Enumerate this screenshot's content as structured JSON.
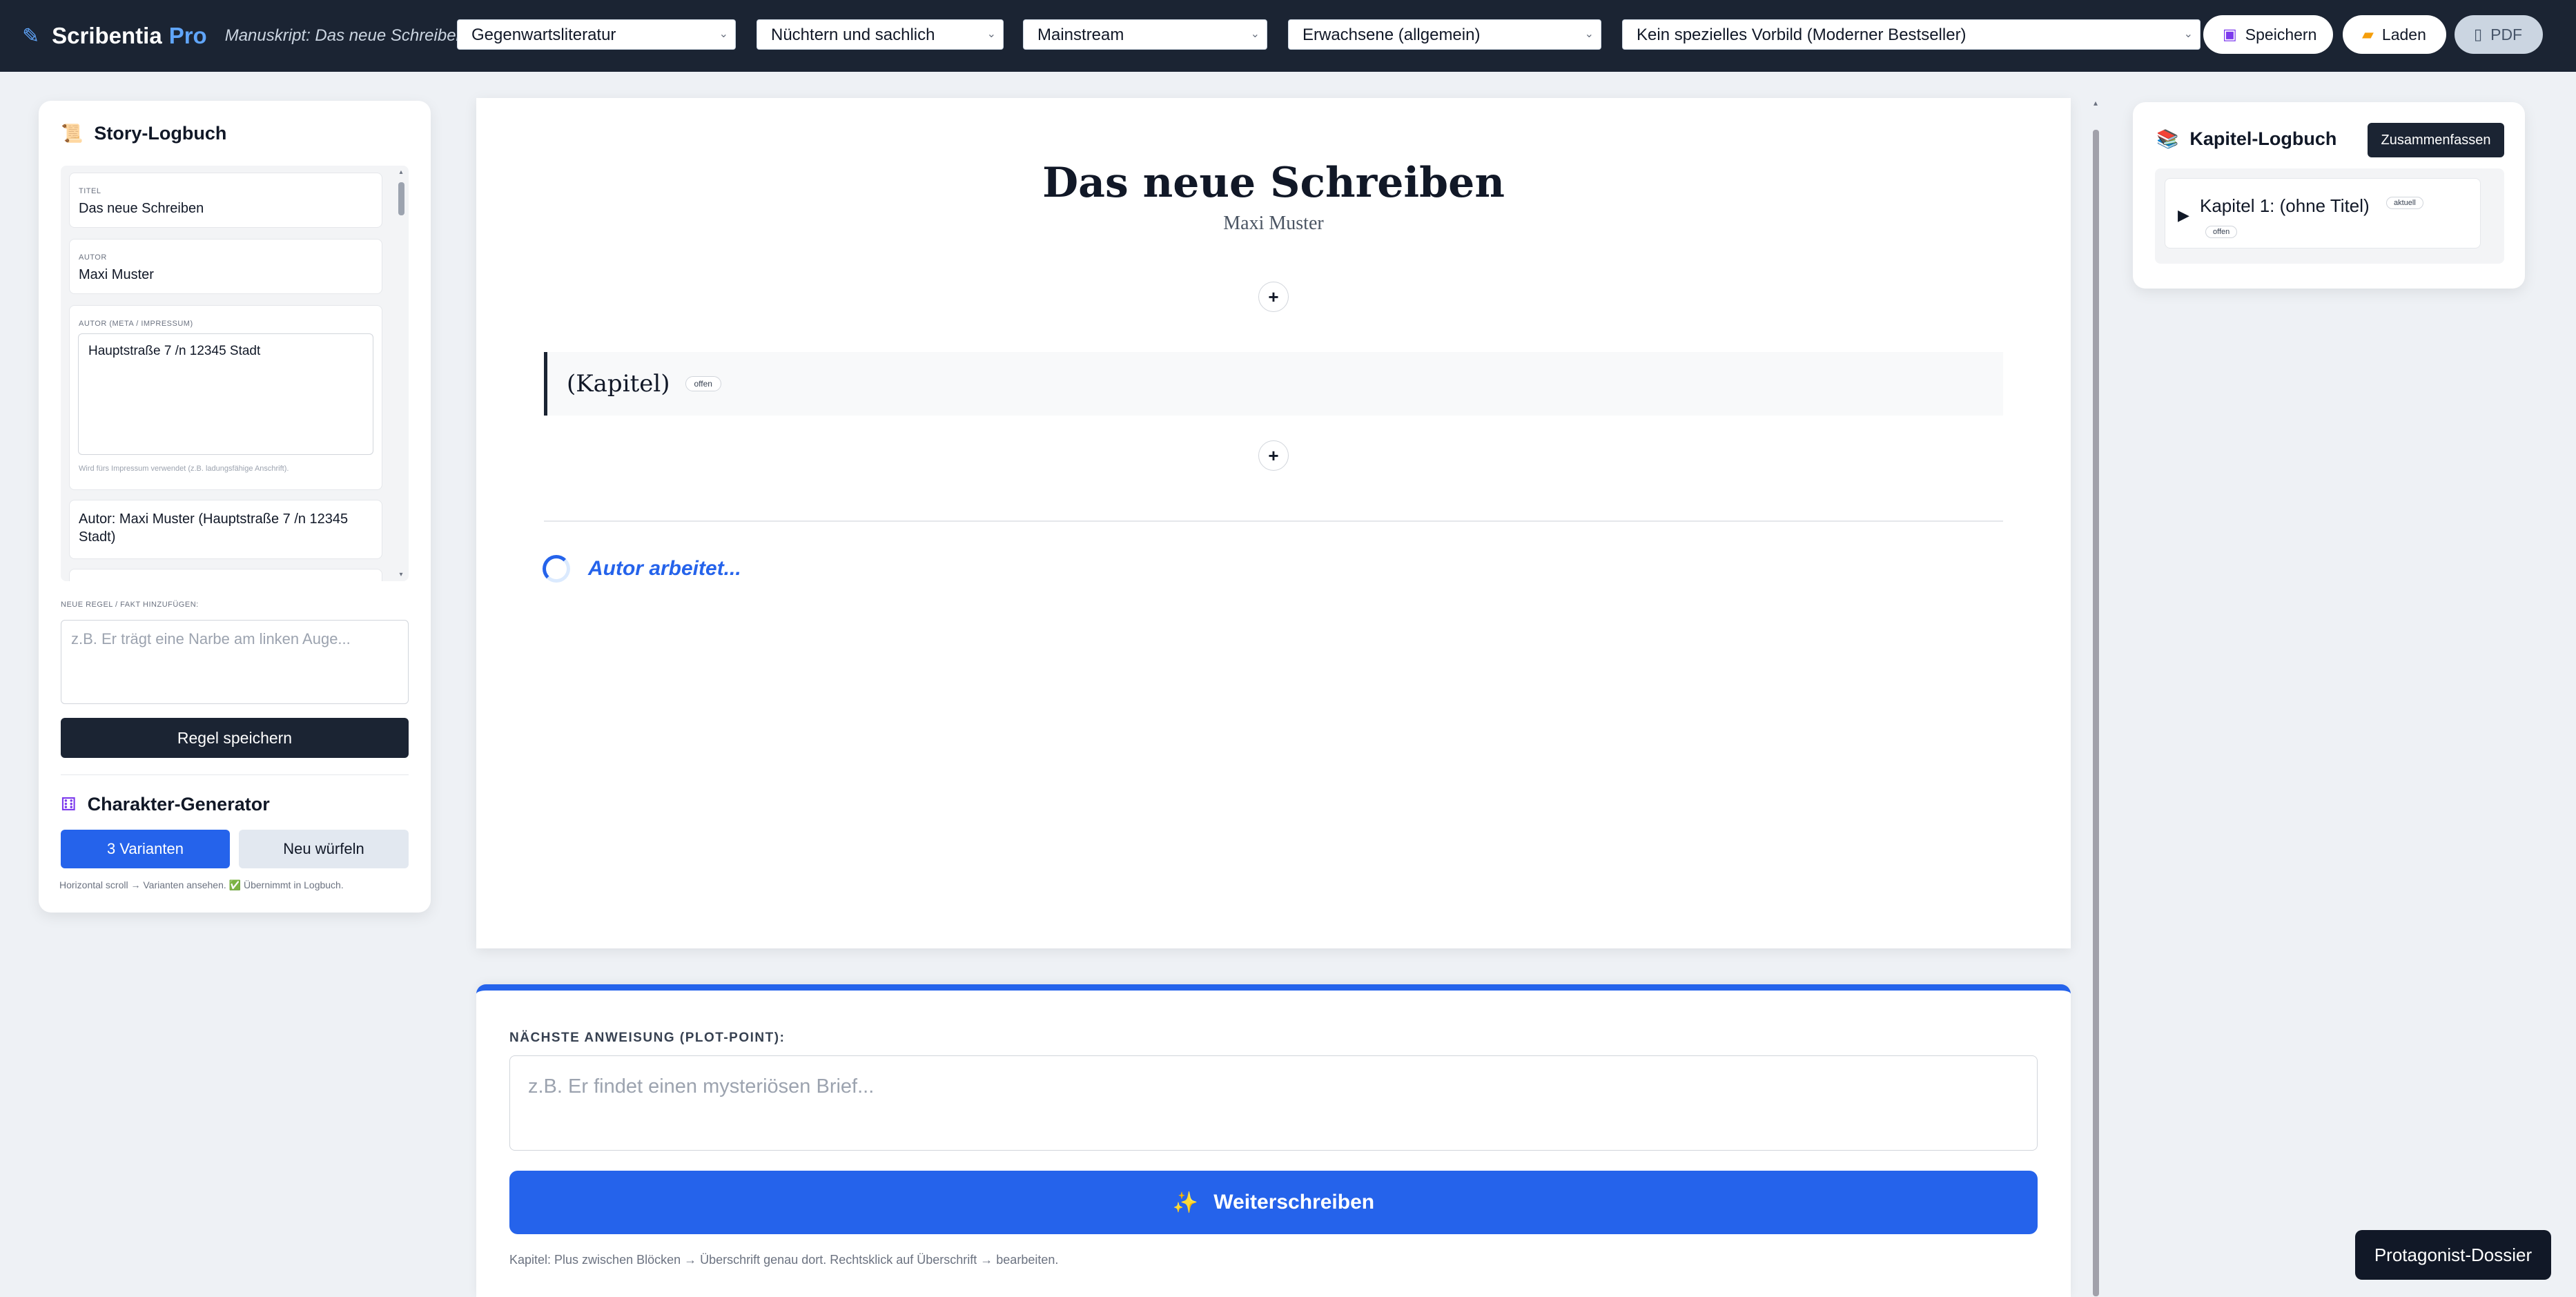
{
  "topbar": {
    "brand_name": "Scribentia",
    "brand_suffix": "Pro",
    "manuscript": "Manuskript: Das neue Schreiben",
    "selects": {
      "genre": "Gegenwartsliteratur",
      "tone": "Nüchtern und sachlich",
      "market": "Mainstream",
      "audience": "Erwachsene (allgemein)",
      "model": "Kein spezielles Vorbild (Moderner Bestseller)"
    },
    "save_label": "Speichern",
    "load_label": "Laden",
    "pdf_label": "PDF"
  },
  "story_log": {
    "title": "Story-Logbuch",
    "fields": {
      "title_label": "TITEL",
      "title_value": "Das neue Schreiben",
      "author_label": "AUTOR",
      "author_value": "Maxi Muster",
      "meta_label": "AUTOR (META / IMPRESSUM)",
      "meta_value": "Hauptstraße 7 /n 12345 Stadt",
      "meta_hint": "Wird fürs Impressum verwendet (z.B. ladungsfähige Anschrift).",
      "entry": "Autor: Maxi Muster (Hauptstraße 7 /n 12345 Stadt)"
    },
    "new_rule_label": "NEUE REGEL / FAKT HINZUFÜGEN:",
    "new_rule_placeholder": "z.B. Er trägt eine Narbe am linken Auge...",
    "save_rule_label": "Regel speichern"
  },
  "char_gen": {
    "title": "Charakter-Generator",
    "variants_label": "3 Varianten",
    "reroll_label": "Neu würfeln",
    "hint_text": "Horizontal scroll → Varianten ansehen.",
    "hint_check": "✅",
    "hint_suffix": "Übernimmt in Logbuch."
  },
  "document": {
    "title": "Das neue Schreiben",
    "author": "Maxi Muster",
    "chapter_title": "(Kapitel)",
    "chapter_status": "offen",
    "working_text": "Autor arbeitet..."
  },
  "composer": {
    "label": "NÄCHSTE ANWEISUNG (PLOT-POINT):",
    "placeholder": "z.B. Er findet einen mysteriösen Brief...",
    "button_label": "Weiterschreiben",
    "footer": "Kapitel: Plus zwischen Blöcken → Überschrift genau dort. Rechtsklick auf Überschrift → bearbeiten."
  },
  "chapter_log": {
    "title": "Kapitel-Logbuch",
    "summarize_label": "Zusammenfassen",
    "items": [
      {
        "name": "Kapitel 1: (ohne Titel)",
        "badge_current": "aktuell",
        "badge_status": "offen"
      }
    ]
  },
  "dossier_label": "Protagonist-Dossier",
  "colors": {
    "accent": "#2563eb",
    "dark": "#1b2433",
    "background": "#eef1f5"
  },
  "icons": {
    "brand": "pen-icon",
    "save": "floppy-icon",
    "load": "folder-icon",
    "pdf": "document-icon",
    "story_log": "scroll-icon",
    "char_gen": "dice-icon",
    "chapter_log": "books-icon",
    "write": "sparkles-icon"
  }
}
